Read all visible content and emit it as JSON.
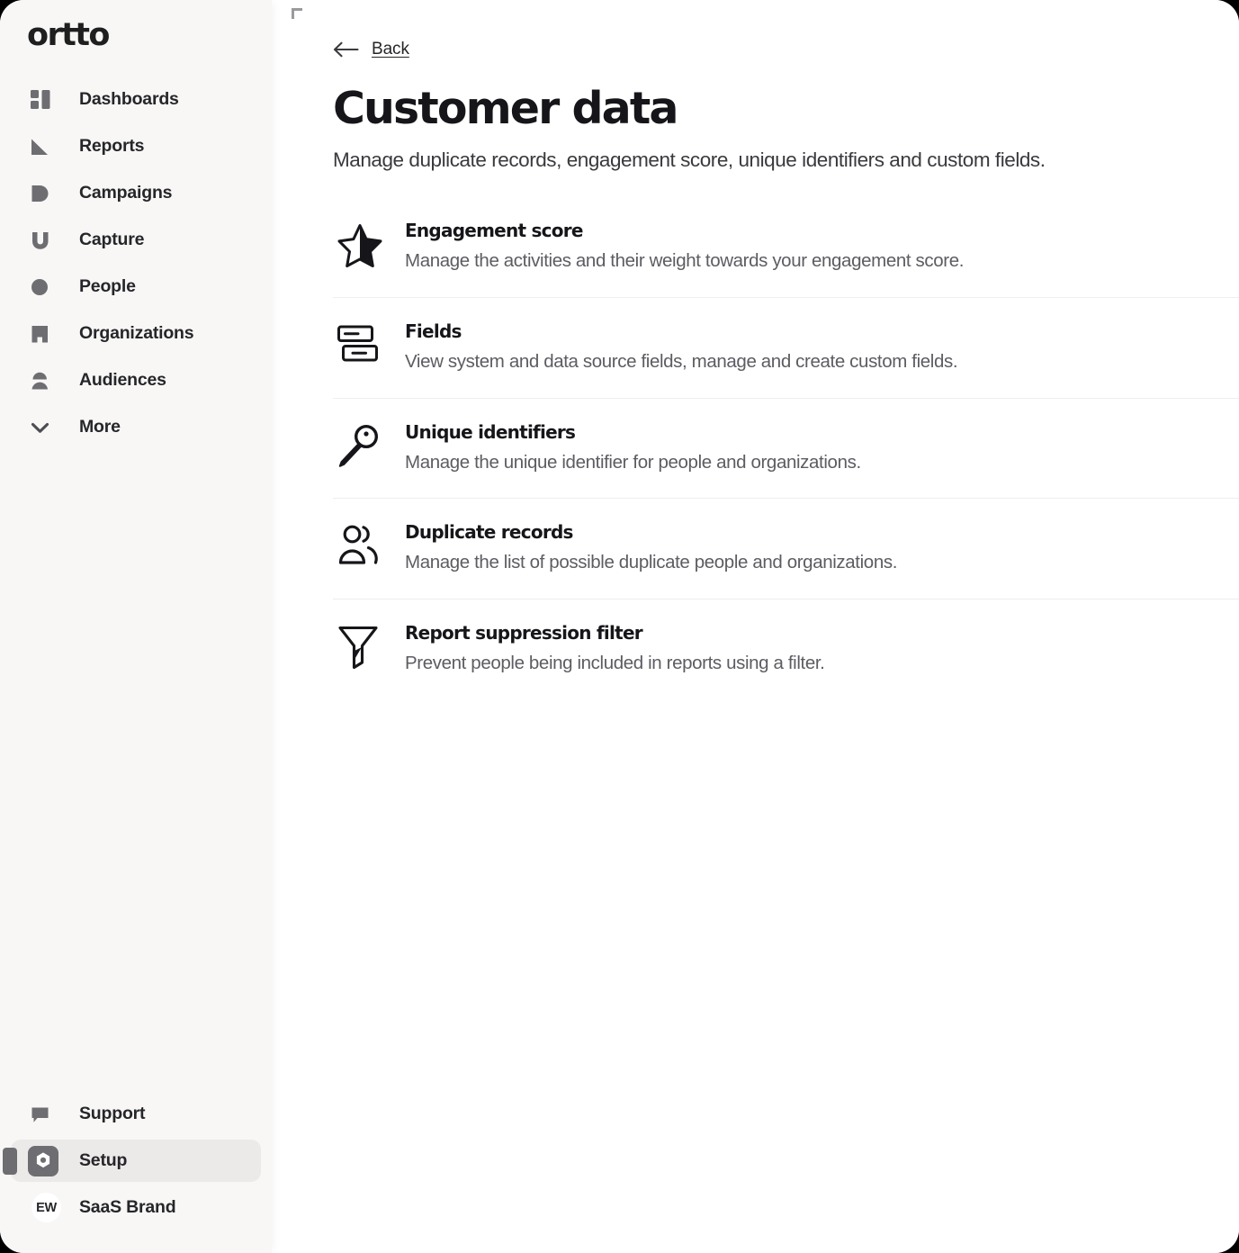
{
  "app": {
    "brand": "ortto"
  },
  "sidebar": {
    "nav_top": [
      {
        "label": "Dashboards",
        "icon": "dashboards-icon"
      },
      {
        "label": "Reports",
        "icon": "reports-icon"
      },
      {
        "label": "Campaigns",
        "icon": "campaigns-icon"
      },
      {
        "label": "Capture",
        "icon": "capture-icon"
      },
      {
        "label": "People",
        "icon": "people-icon"
      },
      {
        "label": "Organizations",
        "icon": "organizations-icon"
      },
      {
        "label": "Audiences",
        "icon": "audiences-icon"
      },
      {
        "label": "More",
        "icon": "chevron-down-icon"
      }
    ],
    "nav_bottom": [
      {
        "label": "Support",
        "icon": "support-chat-icon"
      },
      {
        "label": "Setup",
        "icon": "setup-gear-icon"
      },
      {
        "label": "SaaS Brand",
        "icon": "avatar",
        "avatar_initials": "EW"
      }
    ],
    "active_item": "Setup"
  },
  "main": {
    "back_label": "Back",
    "title": "Customer data",
    "subtitle": "Manage duplicate records, engagement score, unique identifiers and custom fields.",
    "items": [
      {
        "title": "Engagement score",
        "description": "Manage the activities and their weight towards your engagement score.",
        "icon": "star-icon"
      },
      {
        "title": "Fields",
        "description": "View system and data source fields, manage and create custom fields.",
        "icon": "fields-rows-icon"
      },
      {
        "title": "Unique identifiers",
        "description": "Manage the unique identifier for people and organizations.",
        "icon": "key-icon"
      },
      {
        "title": "Duplicate records",
        "description": "Manage the list of possible duplicate people and organizations.",
        "icon": "two-people-icon"
      },
      {
        "title": "Report suppression filter",
        "description": "Prevent people being included in reports using a filter.",
        "icon": "funnel-filter-icon"
      }
    ]
  },
  "colors": {
    "sidebar_bg": "#f8f7f6",
    "main_bg": "#ffffff",
    "active_item_bg": "#eceae8",
    "icon_gray": "#6d6d72",
    "text_primary": "#16161a",
    "text_secondary": "#5c5c62",
    "divider": "#eeeeee"
  }
}
